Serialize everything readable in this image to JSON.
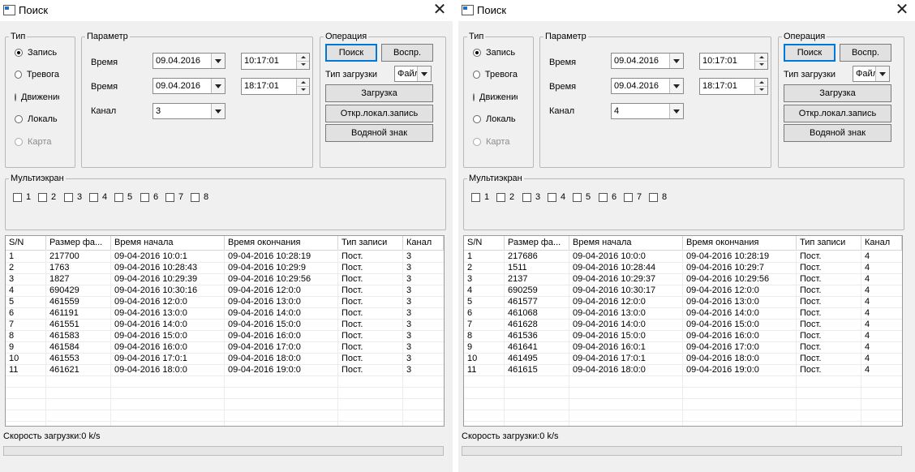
{
  "windows": [
    {
      "title": "Поиск",
      "close_glyph": "✕",
      "type_group": {
        "legend": "Тип",
        "options": [
          {
            "label": "Запись",
            "checked": true,
            "enabled": true
          },
          {
            "label": "Тревога",
            "checked": false,
            "enabled": true
          },
          {
            "label": "Движение",
            "checked": false,
            "enabled": true
          },
          {
            "label": "Локаль",
            "checked": false,
            "enabled": true
          },
          {
            "label": "Карта",
            "checked": false,
            "enabled": false
          }
        ]
      },
      "params": {
        "legend": "Параметр",
        "time_label_1": "Время",
        "start_date": "09.04.2016",
        "start_time": "10:17:01",
        "time_label_2": "Время",
        "end_date": "09.04.2016",
        "end_time": "18:17:01",
        "channel_label": "Канал",
        "channel": "3"
      },
      "operation": {
        "legend": "Операция",
        "search": "Поиск",
        "play": "Воспр.",
        "download_type_label": "Тип загрузки",
        "download_type": "Файл",
        "download": "Загрузка",
        "open_local": "Откр.локал.запись",
        "watermark": "Водяной знак"
      },
      "multiscreen": {
        "legend": "Мультиэкран",
        "items": [
          "1",
          "2",
          "3",
          "4",
          "5",
          "6",
          "7",
          "8"
        ]
      },
      "table": {
        "columns": [
          "S/N",
          "Размер фа...",
          "Время начала",
          "Время окончания",
          "Тип записи",
          "Канал"
        ],
        "rows": [
          [
            "1",
            "217700",
            "09-04-2016 10:0:1",
            "09-04-2016 10:28:19",
            "Пост.",
            "3"
          ],
          [
            "2",
            "1763",
            "09-04-2016 10:28:43",
            "09-04-2016 10:29:9",
            "Пост.",
            "3"
          ],
          [
            "3",
            "1827",
            "09-04-2016 10:29:39",
            "09-04-2016 10:29:56",
            "Пост.",
            "3"
          ],
          [
            "4",
            "690429",
            "09-04-2016 10:30:16",
            "09-04-2016 12:0:0",
            "Пост.",
            "3"
          ],
          [
            "5",
            "461559",
            "09-04-2016 12:0:0",
            "09-04-2016 13:0:0",
            "Пост.",
            "3"
          ],
          [
            "6",
            "461191",
            "09-04-2016 13:0:0",
            "09-04-2016 14:0:0",
            "Пост.",
            "3"
          ],
          [
            "7",
            "461551",
            "09-04-2016 14:0:0",
            "09-04-2016 15:0:0",
            "Пост.",
            "3"
          ],
          [
            "8",
            "461583",
            "09-04-2016 15:0:0",
            "09-04-2016 16:0:0",
            "Пост.",
            "3"
          ],
          [
            "9",
            "461584",
            "09-04-2016 16:0:0",
            "09-04-2016 17:0:0",
            "Пост.",
            "3"
          ],
          [
            "10",
            "461553",
            "09-04-2016 17:0:1",
            "09-04-2016 18:0:0",
            "Пост.",
            "3"
          ],
          [
            "11",
            "461621",
            "09-04-2016 18:0:0",
            "09-04-2016 19:0:0",
            "Пост.",
            "3"
          ]
        ]
      },
      "status": "Скорость загрузки:0 k/s",
      "progress": 0
    },
    {
      "title": "Поиск",
      "close_glyph": "✕",
      "type_group": {
        "legend": "Тип",
        "options": [
          {
            "label": "Запись",
            "checked": true,
            "enabled": true
          },
          {
            "label": "Тревога",
            "checked": false,
            "enabled": true
          },
          {
            "label": "Движение",
            "checked": false,
            "enabled": true
          },
          {
            "label": "Локаль",
            "checked": false,
            "enabled": true
          },
          {
            "label": "Карта",
            "checked": false,
            "enabled": false
          }
        ]
      },
      "params": {
        "legend": "Параметр",
        "time_label_1": "Время",
        "start_date": "09.04.2016",
        "start_time": "10:17:01",
        "time_label_2": "Время",
        "end_date": "09.04.2016",
        "end_time": "18:17:01",
        "channel_label": "Канал",
        "channel": "4"
      },
      "operation": {
        "legend": "Операция",
        "search": "Поиск",
        "play": "Воспр.",
        "download_type_label": "Тип загрузки",
        "download_type": "Файл",
        "download": "Загрузка",
        "open_local": "Откр.локал.запись",
        "watermark": "Водяной знак"
      },
      "multiscreen": {
        "legend": "Мультиэкран",
        "items": [
          "1",
          "2",
          "3",
          "4",
          "5",
          "6",
          "7",
          "8"
        ]
      },
      "table": {
        "columns": [
          "S/N",
          "Размер фа...",
          "Время начала",
          "Время окончания",
          "Тип записи",
          "Канал"
        ],
        "rows": [
          [
            "1",
            "217686",
            "09-04-2016 10:0:0",
            "09-04-2016 10:28:19",
            "Пост.",
            "4"
          ],
          [
            "2",
            "1511",
            "09-04-2016 10:28:44",
            "09-04-2016 10:29:7",
            "Пост.",
            "4"
          ],
          [
            "3",
            "2137",
            "09-04-2016 10:29:37",
            "09-04-2016 10:29:56",
            "Пост.",
            "4"
          ],
          [
            "4",
            "690259",
            "09-04-2016 10:30:17",
            "09-04-2016 12:0:0",
            "Пост.",
            "4"
          ],
          [
            "5",
            "461577",
            "09-04-2016 12:0:0",
            "09-04-2016 13:0:0",
            "Пост.",
            "4"
          ],
          [
            "6",
            "461068",
            "09-04-2016 13:0:0",
            "09-04-2016 14:0:0",
            "Пост.",
            "4"
          ],
          [
            "7",
            "461628",
            "09-04-2016 14:0:0",
            "09-04-2016 15:0:0",
            "Пост.",
            "4"
          ],
          [
            "8",
            "461536",
            "09-04-2016 15:0:0",
            "09-04-2016 16:0:0",
            "Пост.",
            "4"
          ],
          [
            "9",
            "461641",
            "09-04-2016 16:0:1",
            "09-04-2016 17:0:0",
            "Пост.",
            "4"
          ],
          [
            "10",
            "461495",
            "09-04-2016 17:0:1",
            "09-04-2016 18:0:0",
            "Пост.",
            "4"
          ],
          [
            "11",
            "461615",
            "09-04-2016 18:0:0",
            "09-04-2016 19:0:0",
            "Пост.",
            "4"
          ]
        ]
      },
      "status": "Скорость загрузки:0 k/s",
      "progress": 0
    }
  ]
}
